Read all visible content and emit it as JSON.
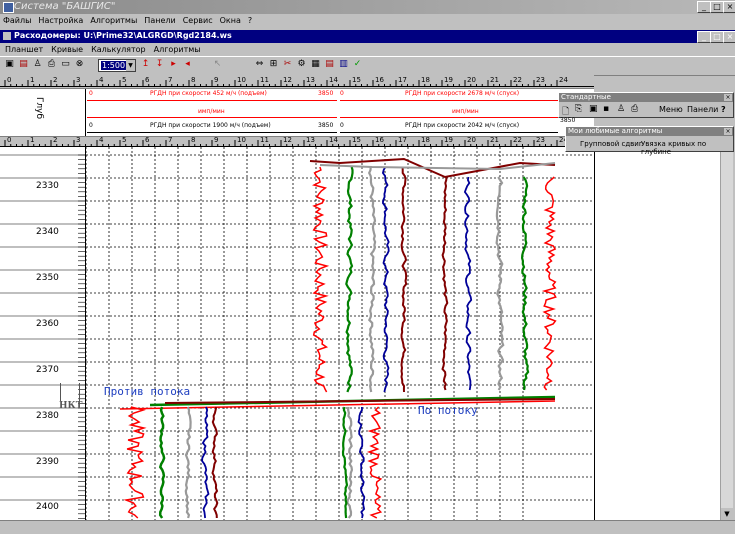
{
  "app": {
    "title": "Система \"БАШГИС\""
  },
  "menu": [
    "Файлы",
    "Настройка",
    "Алгоритмы",
    "Панели",
    "Сервис",
    "Окна",
    "?"
  ],
  "child_window": {
    "title": "Расходомеры: U:\\Prime32\\ALGRGD\\Rgd2184.ws"
  },
  "child_menu": [
    "Планшет",
    "Кривые",
    "Калькулятор",
    "Алгоритмы"
  ],
  "toolbar": {
    "scale_value": "1:500"
  },
  "ruler_ticks": [
    "0",
    "1",
    "2",
    "3",
    "4",
    "5",
    "6",
    "7",
    "8",
    "9",
    "10",
    "11",
    "12",
    "13",
    "14",
    "15",
    "16",
    "17",
    "18",
    "19",
    "20",
    "21",
    "22",
    "23",
    "24"
  ],
  "header": {
    "depth_label": "Глуб",
    "curves": [
      {
        "left_value": "0",
        "name": "РГДН при скорости 452 м/ч (подъем)",
        "right_value": "3850",
        "color": "#ff0000"
      },
      {
        "left_value": "0",
        "name": "РГДН при скорости 2678 м/ч (спуск)",
        "right_value": "",
        "color": "#ff0000"
      },
      {
        "left_value": "",
        "name": "имп/мин",
        "right_value": "",
        "color": "#ff0000"
      },
      {
        "left_value": "",
        "name": "имп/мин",
        "right_value": "",
        "color": "#ff0000"
      },
      {
        "left_value": "0",
        "name": "РГДН при скорости 1900 м/ч (подъем)",
        "right_value": "3850",
        "color": "#000000"
      },
      {
        "left_value": "0",
        "name": "РГДН при скорости 2042 м/ч (спуск)",
        "right_value": "",
        "color": "#000000"
      }
    ]
  },
  "depths": [
    "2330",
    "2340",
    "2350",
    "2360",
    "2370",
    "2380",
    "2390",
    "2400"
  ],
  "annotations": {
    "upstream": "Против потока",
    "downstream": "По потоку",
    "nkt": "НКТ"
  },
  "panel_standard": {
    "title": "Стандартные",
    "items": [
      "Меню",
      "Панели",
      "?"
    ],
    "value": "3850"
  },
  "panel_favorites": {
    "title": "Мои любимые алгоритмы",
    "items": [
      "Групповой сдвиг",
      "Увязка кривых по глубине"
    ]
  },
  "colors": {
    "red": "#ff0000",
    "green": "#008000",
    "gray": "#999999",
    "blue": "#000099",
    "maroon": "#800000"
  }
}
